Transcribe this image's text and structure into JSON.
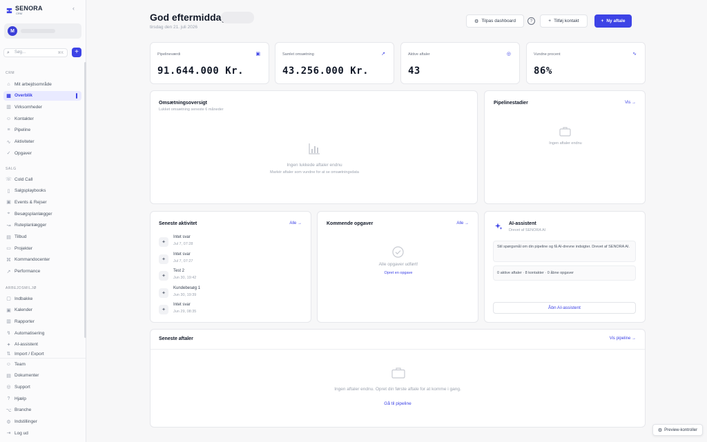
{
  "brand": {
    "name": "SENORA",
    "sub": "CRM",
    "accent": "#3d43e6"
  },
  "user": {
    "initial": "M"
  },
  "search": {
    "placeholder": "Søg...",
    "shortcut": "⌘K"
  },
  "sections": {
    "crm": "CRM",
    "salg": "SALG",
    "arbejdsmiljo": "ARBEJDSMILJØ"
  },
  "nav": {
    "crm": [
      {
        "label": "Mit arbejdsområde",
        "icon": "home-icon"
      },
      {
        "label": "Overblik",
        "icon": "grid-icon",
        "active": true
      },
      {
        "label": "Virksomheder",
        "icon": "building-icon"
      },
      {
        "label": "Kontakter",
        "icon": "users-icon"
      },
      {
        "label": "Pipeline",
        "icon": "pipeline-icon"
      },
      {
        "label": "Aktiviteter",
        "icon": "activity-icon"
      },
      {
        "label": "Opgaver",
        "icon": "check-icon"
      }
    ],
    "salg": [
      {
        "label": "Cold Call",
        "icon": "phone-icon"
      },
      {
        "label": "Salgsplaybooks",
        "icon": "book-icon"
      },
      {
        "label": "Events & Rejser",
        "icon": "calendar-icon"
      },
      {
        "label": "Besøgsplanlægger",
        "icon": "map-icon"
      },
      {
        "label": "Ruteplanlægger",
        "icon": "route-icon"
      },
      {
        "label": "Tilbud",
        "icon": "file-icon"
      },
      {
        "label": "Projekter",
        "icon": "folder-icon"
      },
      {
        "label": "Kommandocenter",
        "icon": "command-icon"
      },
      {
        "label": "Performance",
        "icon": "trend-icon"
      }
    ],
    "arbejdsmiljo": [
      {
        "label": "Indbakke",
        "icon": "inbox-icon"
      },
      {
        "label": "Kalender",
        "icon": "calendar-icon"
      },
      {
        "label": "Rapporter",
        "icon": "report-icon"
      },
      {
        "label": "Automatisering",
        "icon": "bolt-icon"
      },
      {
        "label": "AI-assistent",
        "icon": "sparkle-icon"
      },
      {
        "label": "Import / Export",
        "icon": "import-icon"
      }
    ],
    "bottom": [
      {
        "label": "Team",
        "icon": "users-icon"
      },
      {
        "label": "Dokumenter",
        "icon": "doc-icon"
      },
      {
        "label": "Support",
        "icon": "support-icon"
      },
      {
        "label": "Hjælp",
        "icon": "help-icon"
      },
      {
        "label": "Branche",
        "icon": "branch-icon"
      },
      {
        "label": "Indstillinger",
        "icon": "gear-icon"
      },
      {
        "label": "Log ud",
        "icon": "logout-icon"
      }
    ]
  },
  "header": {
    "greeting": "God eftermiddag",
    "date": "tirsdag den 21. juli 2026",
    "customize": "Tilpas dashboard",
    "add_contact": "Tilføj kontakt",
    "new_deal": "Ny aftale"
  },
  "stats": [
    {
      "label": "Pipelineværdi",
      "value": "91.644.000 Kr.",
      "icon": "briefcase-icon"
    },
    {
      "label": "Samlet omsætning",
      "value": "43.256.000 Kr.",
      "icon": "trend-up-icon"
    },
    {
      "label": "Aktive aftaler",
      "value": "43",
      "icon": "target-icon"
    },
    {
      "label": "Vundne procent",
      "value": "86%",
      "icon": "pulse-icon"
    }
  ],
  "revenue": {
    "title": "Omsætningsoversigt",
    "subtitle": "Lukket omsætning seneste 6 måneder",
    "empty": "Ingen lukkede aftaler endnu",
    "empty_sub": "Markér aftaler som vundne for at se omsætningsdata"
  },
  "stages": {
    "title": "Pipelinestadier",
    "link": "Vis →",
    "empty": "Ingen aftaler endnu"
  },
  "activities": {
    "title": "Seneste aktivitet",
    "link": "Alle →",
    "items": [
      {
        "name": "Intet svar",
        "time": "Jul 7, 07:28"
      },
      {
        "name": "Intet svar",
        "time": "Jul 7, 07:27"
      },
      {
        "name": "Test 2",
        "time": "Jun 30, 19:42"
      },
      {
        "name": "Kundebesøg 1",
        "time": "Jun 30, 19:39"
      },
      {
        "name": "Intet svar",
        "time": "Jun 29, 08:35"
      }
    ]
  },
  "tasks": {
    "title": "Kommende opgaver",
    "link": "Alle →",
    "empty": "Alle opgaver udført!",
    "create": "Opret en opgave"
  },
  "ai": {
    "title": "AI-assistent",
    "sub": "Drevet af SENORA AI",
    "msg1": "Stil spørgsmål om din pipeline og få AI-drevne indsigter. Drevet af SENORA AI.",
    "msg2": "0 aktive aftaler · 8 kontakter · 0 åbne opgaver",
    "button": "Åbn AI-assistent"
  },
  "deals": {
    "title": "Seneste aftaler",
    "link": "Vis pipeline →",
    "empty": "Ingen aftaler endnu. Opret din første aftale for at komme i gang.",
    "cta": "Gå til pipeline"
  },
  "preview": "Preview-kontroller"
}
